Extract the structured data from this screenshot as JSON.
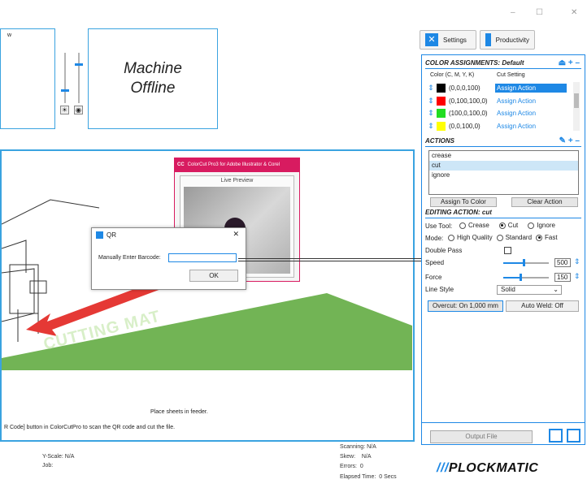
{
  "window_controls": {
    "minimize": "–",
    "maximize": "☐",
    "close": "✕"
  },
  "top_left": {
    "partial_label": "w"
  },
  "status_box": {
    "line1": "Machine",
    "line2": "Offline"
  },
  "toolbar": {
    "settings_label": "Settings",
    "productivity_label": "Productivity"
  },
  "color_assignments": {
    "title": "COLOR ASSIGNMENTS: Default",
    "col_color": "Color (C, M, Y, K)",
    "col_cut": "Cut Setting",
    "rows": [
      {
        "value": "(0,0,0,100)",
        "swatch": "#000000",
        "action": "Assign Action",
        "selected": true
      },
      {
        "value": "(0,100,100,0)",
        "swatch": "#ff0000",
        "action": "Assign Action",
        "selected": false
      },
      {
        "value": "(100,0,100,0)",
        "swatch": "#22dd22",
        "action": "Assign Action",
        "selected": false
      },
      {
        "value": "(0,0,100,0)",
        "swatch": "#ffff00",
        "action": "Assign Action",
        "selected": false
      }
    ]
  },
  "actions": {
    "title": "ACTIONS",
    "items": [
      "crease",
      "cut",
      "ignore"
    ],
    "selected_index": 1,
    "assign_button": "Assign To Color",
    "clear_button": "Clear Action"
  },
  "editing": {
    "title": "EDITING ACTION: cut",
    "use_tool_label": "Use Tool:",
    "tools": [
      "Crease",
      "Cut",
      "Ignore"
    ],
    "tool_selected": "Cut",
    "mode_label": "Mode:",
    "modes": [
      "High Quality",
      "Standard",
      "Fast"
    ],
    "mode_selected": "Fast",
    "double_pass_label": "Double Pass",
    "speed_label": "Speed",
    "speed_value": "500",
    "force_label": "Force",
    "force_value": "150",
    "line_style_label": "Line Style",
    "line_style_value": "Solid",
    "overcut_button": "Overcut: On 1,000 mm",
    "autoweld_button": "Auto Weld: Off"
  },
  "output_button": "Output File",
  "preview_window": {
    "title": "ColorCut Pro3 for Adobe Illustrator & Corel",
    "app_badge": "CC",
    "live_label": "Live Preview"
  },
  "qr_dialog": {
    "title": "QR",
    "field_label": "Manually Enter Barcode:",
    "field_value": "",
    "ok_label": "OK",
    "close": "✕"
  },
  "canvas_text": {
    "mat_text": "CUTTING MAT",
    "instruction1": "Place sheets in feeder.",
    "instruction2": "R Code] button in ColorCutPro to scan the QR code and cut the file."
  },
  "status_bar": {
    "yscale": "Y-Scale: N/A",
    "job": "Job:",
    "scanning": "Scanning: N/A",
    "skew": "Skew:    N/A",
    "errors": "Errors:  0",
    "elapsed": "Elapsed Time:  0 Secs"
  },
  "brand": {
    "name": "PLOCKMATIC",
    "slashes": "///"
  }
}
